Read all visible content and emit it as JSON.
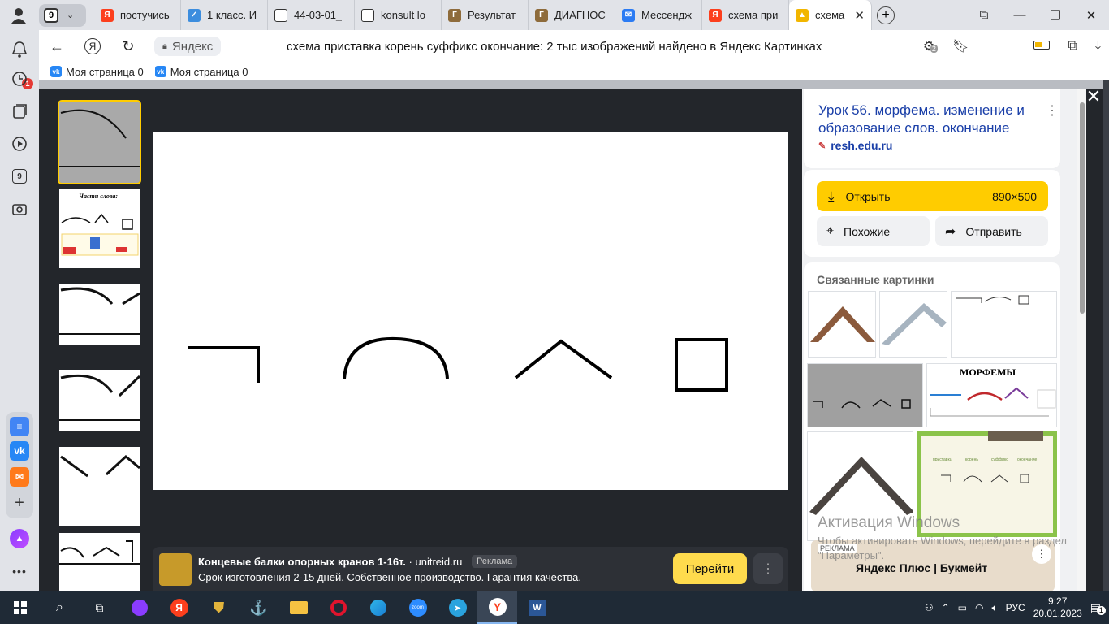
{
  "tabs": {
    "counter": "9",
    "items": [
      {
        "title": "постучись",
        "fav_color": "#fc3f1d",
        "fav_text": "Я"
      },
      {
        "title": "1 класс. И",
        "fav_color": "#3c8dde",
        "fav_text": "✓"
      },
      {
        "title": "44-03-01_",
        "fav_color": "#ffffff",
        "fav_text": ""
      },
      {
        "title": "konsult lo",
        "fav_color": "#ffffff",
        "fav_text": ""
      },
      {
        "title": "Результат",
        "fav_color": "#8e6b3b",
        "fav_text": "Г"
      },
      {
        "title": "ДИАГНОС",
        "fav_color": "#8e6b3b",
        "fav_text": "Г"
      },
      {
        "title": "Мессендж",
        "fav_color": "#2b7bf3",
        "fav_text": "✉"
      },
      {
        "title": "схема при",
        "fav_color": "#fc3f1d",
        "fav_text": "Я"
      }
    ],
    "active": {
      "title": "схема п",
      "fav_color": "#f2b600"
    }
  },
  "sidebar": {
    "notifications_badge": "1",
    "tabs_count": "9"
  },
  "address_bar": {
    "site_chip": "Яндекс",
    "page_title": "схема приставка корень суффикс окончание: 2 тыс изображений найдено в Яндекс Картинках",
    "counter": "2"
  },
  "bookmarks": [
    {
      "label": "Моя страница 0"
    },
    {
      "label": "Моя страница 0"
    }
  ],
  "ad": {
    "title": "Концевые балки опорных кранов 1-16т.",
    "domain": "· unitreid.ru",
    "label": "Реклама",
    "description": "Срок изготовления 2-15 дней. Собственное производство. Гарантия качества.",
    "go_button": "Перейти"
  },
  "right_panel": {
    "title": "Урок 56. морфема. изменение и образование слов. окончание",
    "site": "resh.edu.ru",
    "open_label": "Открыть",
    "image_size": "890×500",
    "similar_label": "Похожие",
    "share_label": "Отправить",
    "related_title": "Связанные картинки",
    "related_morphemes_caption": "МОРФЕМЫ",
    "related_green_labels": [
      "приставка",
      "корень",
      "суффикс",
      "окончание"
    ]
  },
  "watermark": {
    "line1": "Активация Windows",
    "line2": "Чтобы активировать Windows, перейдите в раздел \"Параметры\"."
  },
  "promo": {
    "label": "РЕКЛАМА",
    "text": "Яндекс Плюс  |  Букмейт"
  },
  "taskbar": {
    "lang": "РУС",
    "time": "9:27",
    "date": "20.01.2023",
    "notif_count": "1"
  },
  "thumbnail_1_caption": "Части слова:"
}
